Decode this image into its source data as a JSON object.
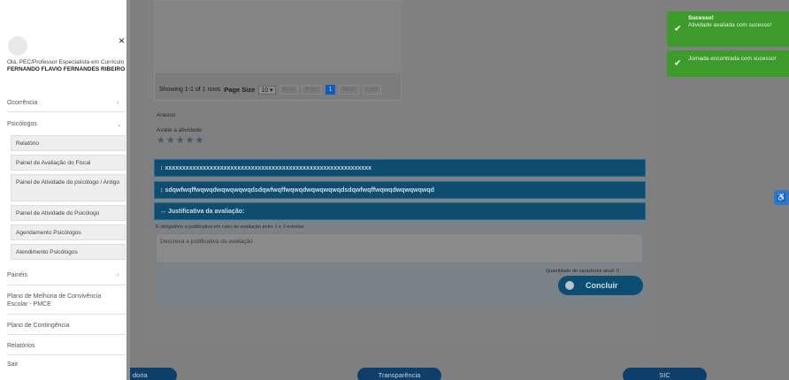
{
  "table": {
    "showing": "Showing 1-1 of 1 rows",
    "page_size_label": "Page Size",
    "page_size_value": "10 ▾",
    "first": "First",
    "prev": "Prev",
    "current": "1",
    "next": "Next",
    "last": "Last"
  },
  "anexos_label": "Anexos",
  "avalie_label": "Avalie a atividade:",
  "stars": "★★★★★",
  "bars": [
    "↕ xxxxxxxxxxxxxxxxxxxxxxxxxxxxxxxxxxxxxxxxxxxxxxxxxxxxxxxxxxxx",
    "↕ sdqwfwqffwqwqdwqwqwqwqdsdqwfwqffwqwqdwqwqwqwqdsdqwfwqffwqwqdwqwqwqwqd"
  ],
  "justificativa": {
    "title": "↔ Justificativa da avaliação:",
    "note": "É obrigatório a justificativa em caso de avaliação entre 1 e 3 estrelas",
    "placeholder": "Descreva a justificativa da avaliação",
    "count": "Quantidade de caracteres atual: 0",
    "button": "Concluir"
  },
  "footer": {
    "ouvidoria": "doria",
    "transparencia": "Transparência",
    "sic": "SIC"
  },
  "sidebar": {
    "close": "×",
    "greeting": "Olá, PEC/Professor Especialista em Currículo",
    "user": "FERNANDO FLAVIO FERNANDES RIBEIRO",
    "ocorrencia": "Ocorrência",
    "psicologos": "Psicólogos",
    "psicologos_items": [
      "Relatório",
      "Painel de Avaliação do Fiscal",
      "Painel de Atividade do psicólogo / Antigo",
      "Painel de Atividade do Psicólogo",
      "Agendamento Psicólogos",
      "Atendimento Psicólogos"
    ],
    "paineis": "Painéis",
    "plano_melhoria": "Plano de Melhoria de Convivência Escolar - PMCE",
    "plano_contingencia": "Plano de Contingência",
    "relatorios": "Relatórios",
    "sair": "Sair"
  },
  "toasts": [
    {
      "title": "Sucesso!",
      "msg": "Atividade avaliada com sucesso!"
    },
    {
      "title": "",
      "msg": "Jornada encontrada com sucesso!"
    }
  ],
  "colors": {
    "toast": "#3d9b2c",
    "bar": "#0e4d6f",
    "accent": "#0a5fbd"
  }
}
